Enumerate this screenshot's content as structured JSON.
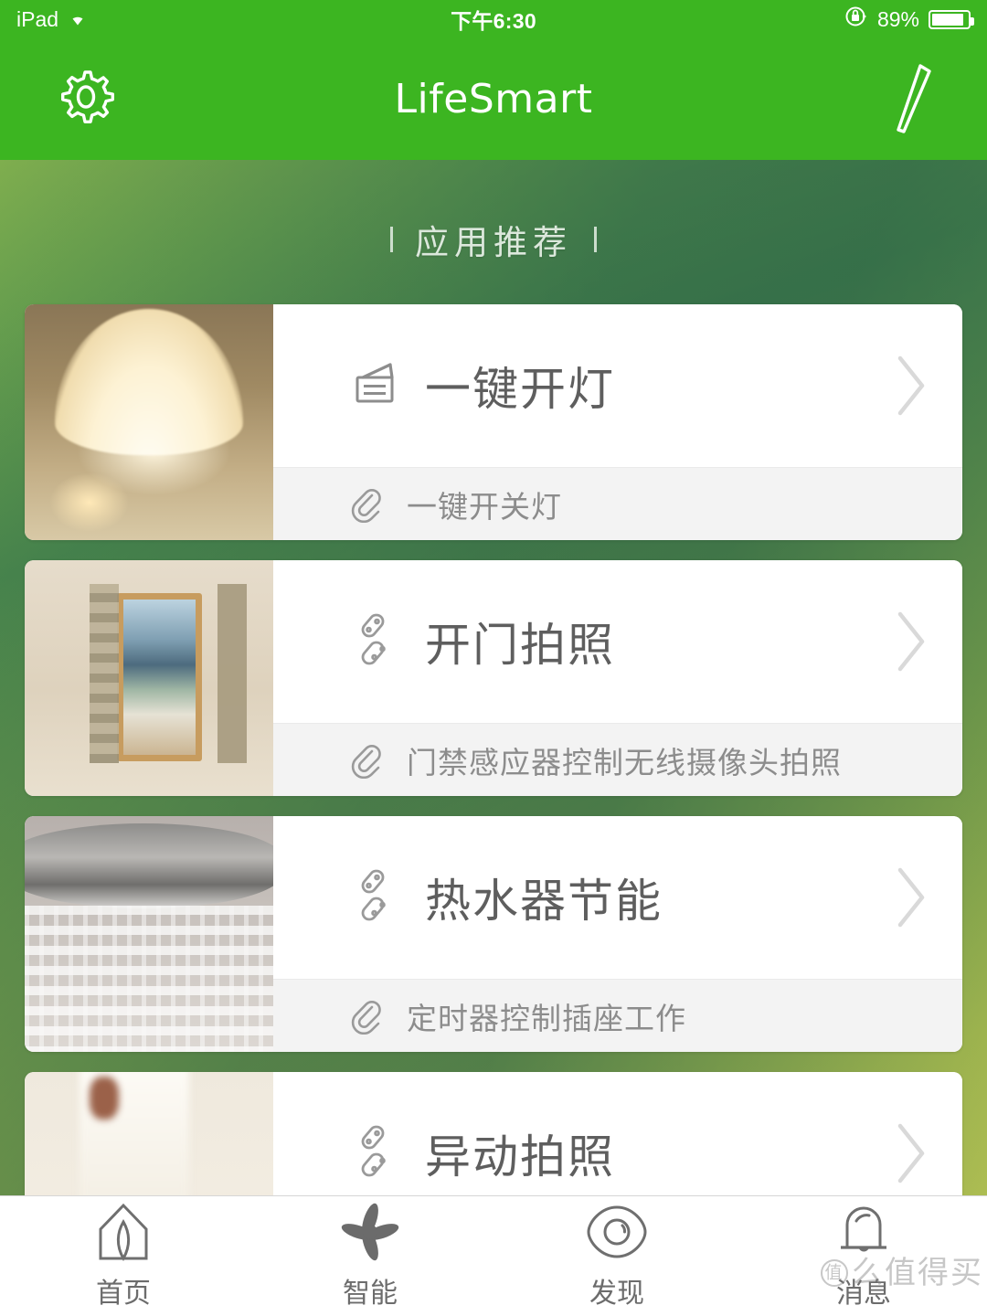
{
  "status_bar": {
    "carrier": "iPad",
    "wifi_icon": "wifi-icon",
    "time": "下午6:30",
    "rotation_lock_icon": "rotation-lock-icon",
    "battery_percent": "89%",
    "battery_level": 89
  },
  "navbar": {
    "settings_icon": "gear-icon",
    "title": "LifeSmart",
    "edit_icon": "pencil-icon",
    "background_color": "#3cb521"
  },
  "section": {
    "title": "应用推荐"
  },
  "cards": [
    {
      "title": "一键开灯",
      "subtitle": "一键开关灯",
      "icon": "switch-panel-icon",
      "sub_icon": "paperclip-icon",
      "chevron": "chevron-right-icon",
      "thumbnail": "pendant-lamp-photo"
    },
    {
      "title": "开门拍照",
      "subtitle": "门禁感应器控制无线摄像头拍照",
      "icon": "chain-link-icon",
      "sub_icon": "paperclip-icon",
      "chevron": "chevron-right-icon",
      "thumbnail": "open-door-balcony-photo"
    },
    {
      "title": "热水器节能",
      "subtitle": "定时器控制插座工作",
      "icon": "chain-link-icon",
      "sub_icon": "paperclip-icon",
      "chevron": "chevron-right-icon",
      "thumbnail": "shower-head-photo"
    },
    {
      "title": "异动拍照",
      "subtitle": "",
      "icon": "chain-link-icon",
      "sub_icon": "paperclip-icon",
      "chevron": "chevron-right-icon",
      "thumbnail": "person-walking-photo"
    }
  ],
  "tabbar": [
    {
      "label": "首页",
      "icon": "home-icon",
      "active": false
    },
    {
      "label": "智能",
      "icon": "flower-star-icon",
      "active": true
    },
    {
      "label": "发现",
      "icon": "eye-icon",
      "active": false
    },
    {
      "label": "消息",
      "icon": "bell-icon",
      "active": false
    }
  ],
  "watermark": {
    "text": "么值得买"
  },
  "colors": {
    "brand_green": "#3cb521",
    "gradient_top": "#2f6b4a",
    "gradient_bottom": "#adbd52",
    "card_white": "#ffffff",
    "card_sub_gray": "#f3f3f3",
    "text_gray": "#5e5e5e"
  }
}
